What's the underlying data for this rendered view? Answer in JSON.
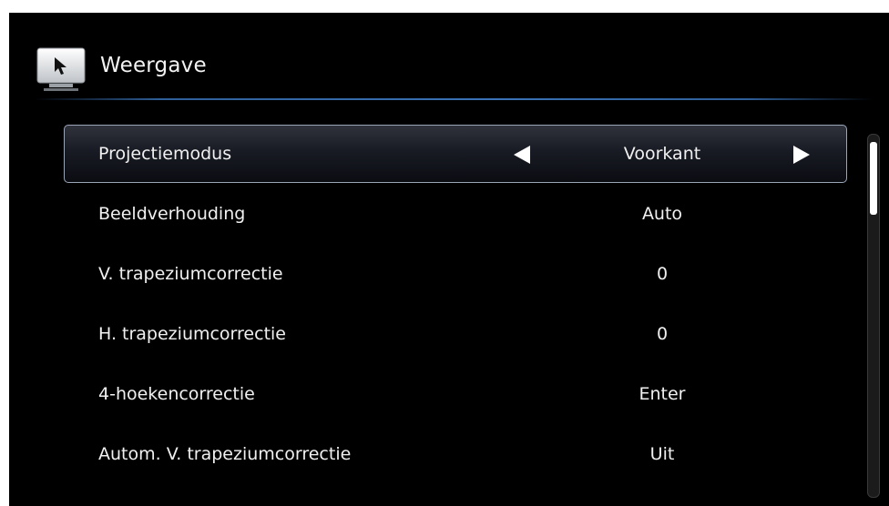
{
  "header": {
    "title": "Weergave",
    "icon": "display-settings-icon"
  },
  "menu": {
    "items": [
      {
        "label": "Projectiemodus",
        "value": "Voorkant",
        "selected": true
      },
      {
        "label": "Beeldverhouding",
        "value": "Auto"
      },
      {
        "label": "V. trapeziumcorrectie",
        "value": "0"
      },
      {
        "label": "H. trapeziumcorrectie",
        "value": "0"
      },
      {
        "label": "4-hoekencorrectie",
        "value": "Enter"
      },
      {
        "label": "Autom. V. trapeziumcorrectie",
        "value": "Uit"
      }
    ]
  },
  "colors": {
    "background": "#000000",
    "accent_line": "#3a73b8",
    "text": "#f0f0f0"
  }
}
